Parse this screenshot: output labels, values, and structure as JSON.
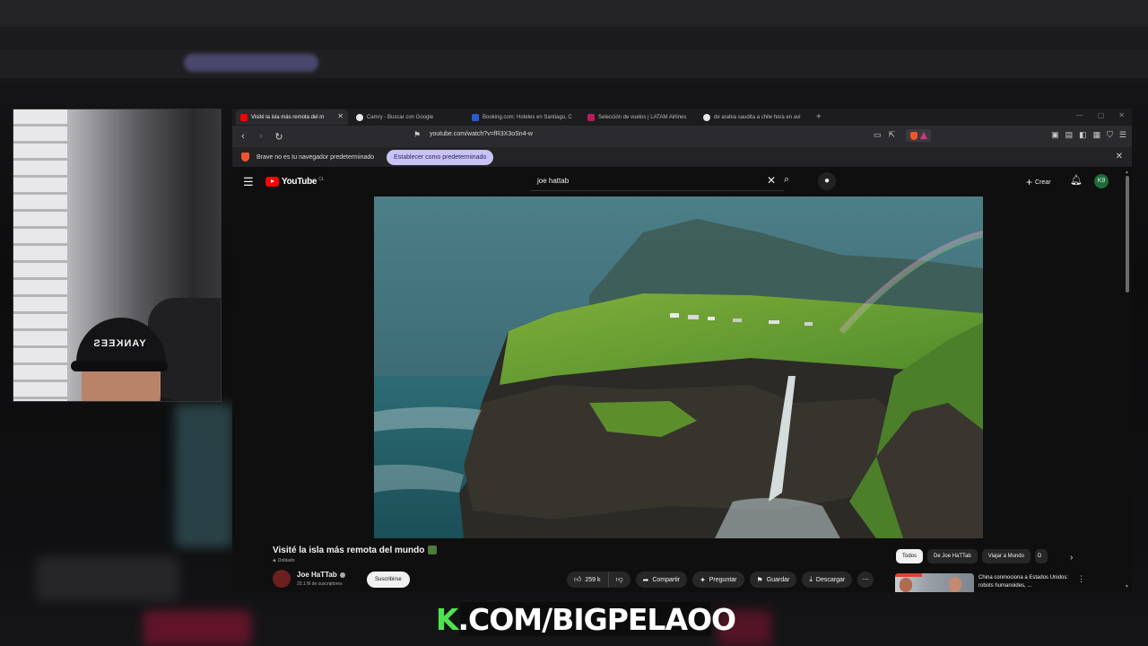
{
  "browser": {
    "tabs": [
      {
        "label": "Visité la isla más remota del m",
        "active": true,
        "favicon_color": "#ff0000"
      },
      {
        "label": "Camry - Buscar con Google",
        "active": false,
        "favicon_color": "#e8e8e8"
      },
      {
        "label": "Booking.com: Hoteles en Santiago, C",
        "active": false,
        "favicon_color": "#2a5bd7"
      },
      {
        "label": "Selección de vuelos | LATAM Airlines",
        "active": false,
        "favicon_color": "#c2185b"
      },
      {
        "label": "de arabia saudita a chile hora en avi",
        "active": false,
        "favicon_color": "#e8e8e8"
      }
    ],
    "new_tab": "+",
    "url": "youtube.com/watch?v=fR3X3oSn4-w",
    "infobar": {
      "message": "Brave no es tu navegador predeterminado",
      "button": "Establecer como predeterminado",
      "close": "✕"
    }
  },
  "youtube": {
    "logo": "YouTube",
    "region": "CL",
    "search_value": "joe hattab",
    "create_label": "Crear",
    "avatar_initials": "K9",
    "video": {
      "title": "Visité la isla más remota del mundo",
      "dubbed": "Doblado",
      "channel": "Joe HaTTab",
      "subscribers": "20.1 M de suscriptores",
      "subscribe_label": "Suscribirse",
      "likes": "259 k",
      "share": "Compartir",
      "ask": "Preguntar",
      "save": "Guardar",
      "download": "Descargar"
    },
    "chips": [
      "Todos",
      "De Joe HaTTab",
      "Viajar a Mundo",
      "D"
    ],
    "recommendation": {
      "title": "China conmociona a Estados Unidos: robots humanoides, ..."
    }
  },
  "webcam": {
    "cap_text": "YANKEES"
  },
  "overlay": {
    "k": "K",
    "rest": ".COM/BIGPELAOO"
  }
}
